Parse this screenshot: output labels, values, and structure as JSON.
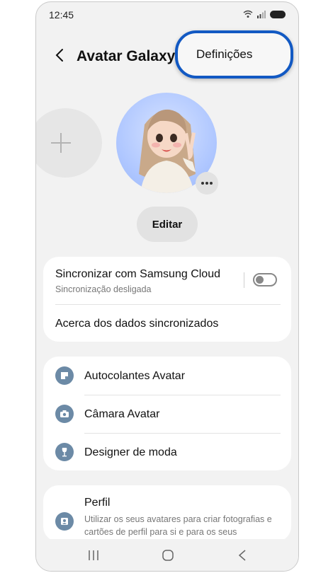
{
  "status_bar": {
    "time": "12:45"
  },
  "header": {
    "title": "Avatar Galaxy"
  },
  "menu": {
    "settings_label": "Definições"
  },
  "buttons": {
    "edit_label": "Editar"
  },
  "sync_card": {
    "title": "Sincronizar com Samsung Cloud",
    "subtitle": "Sincronização desligada",
    "toggle_on": false,
    "about_label": "Acerca dos dados sincronizados"
  },
  "features": [
    {
      "label": "Autocolantes Avatar",
      "icon": "sticker-icon"
    },
    {
      "label": "Câmara Avatar",
      "icon": "camera-icon"
    },
    {
      "label": "Designer de moda",
      "icon": "dress-form-icon"
    }
  ],
  "profile": {
    "title": "Perfil",
    "description": "Utilizar os seus avatares para criar fotografias e cartões de perfil para si e para os seus",
    "icon": "profile-card-icon"
  },
  "colors": {
    "accent_highlight": "#1259c3",
    "icon_bg": "#6c8aa6",
    "background": "#f2f2f2"
  }
}
